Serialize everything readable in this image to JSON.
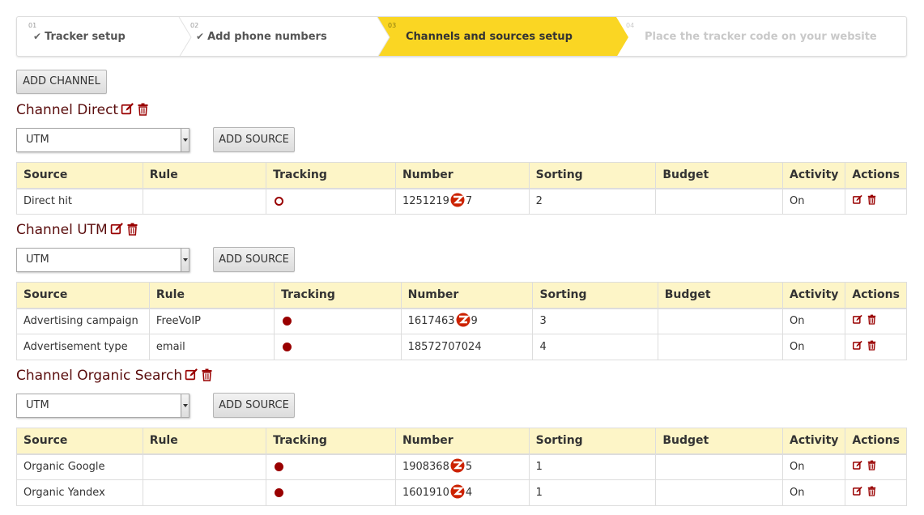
{
  "wizard": {
    "steps": [
      {
        "num": "01",
        "label": "Tracker setup",
        "state": "done"
      },
      {
        "num": "02",
        "label": "Add phone numbers",
        "state": "done"
      },
      {
        "num": "03",
        "label": "Channels and sources setup",
        "state": "active"
      },
      {
        "num": "04",
        "label": "Place the tracker code on your website",
        "state": "pending"
      }
    ],
    "active_color": "#fad623"
  },
  "add_channel_label": "ADD CHANNEL",
  "add_source_label": "ADD SOURCE",
  "columns": [
    "Source",
    "Rule",
    "Tracking",
    "Number",
    "Sorting",
    "Budget",
    "Activity",
    "Actions"
  ],
  "channels": [
    {
      "title": "Channel Direct",
      "select_value": "UTM",
      "rows": [
        {
          "source": "Direct hit",
          "rule": "",
          "tracking": "off",
          "number_a": "1251219",
          "number_b": "7",
          "sorting": "2",
          "budget": "",
          "activity": "On"
        }
      ]
    },
    {
      "title": "Channel UTM",
      "select_value": "UTM",
      "rows": [
        {
          "source": "Advertising campaign",
          "rule": "FreeVoIP",
          "tracking": "on",
          "number_a": "1617463",
          "number_b": "9",
          "sorting": "3",
          "budget": "",
          "activity": "On"
        },
        {
          "source": "Advertisement type",
          "rule": "email",
          "tracking": "on",
          "number_a": "18572707024",
          "number_b": "",
          "sorting": "4",
          "budget": "",
          "activity": "On"
        }
      ]
    },
    {
      "title": "Channel Organic Search",
      "select_value": "UTM",
      "rows": [
        {
          "source": "Organic Google",
          "rule": "",
          "tracking": "on",
          "number_a": "1908368",
          "number_b": "5",
          "sorting": "1",
          "budget": "",
          "activity": "On"
        },
        {
          "source": "Organic Yandex",
          "rule": "",
          "tracking": "on",
          "number_a": "1601910",
          "number_b": "4",
          "sorting": "1",
          "budget": "",
          "activity": "On"
        }
      ]
    }
  ],
  "colors": {
    "accent": "#990000",
    "title": "#5a0d0d",
    "header_bg": "#fdf5c7"
  }
}
